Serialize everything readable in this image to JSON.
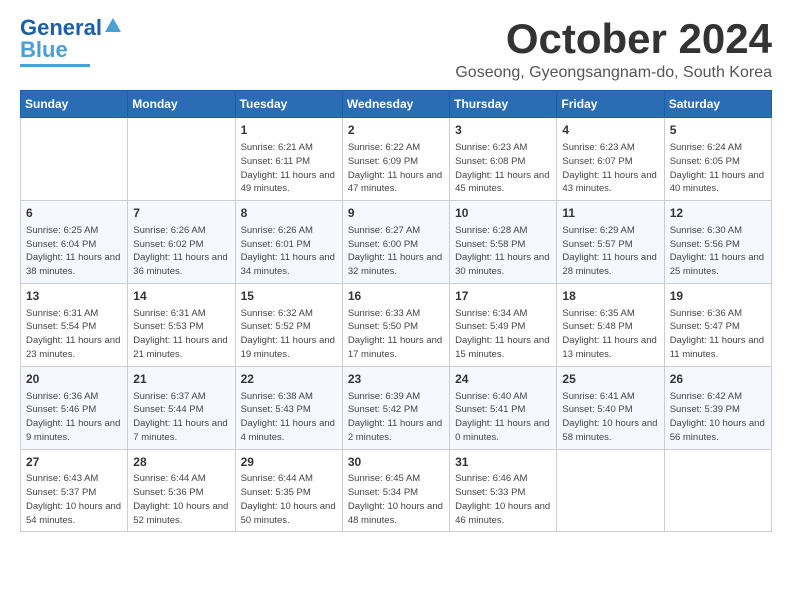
{
  "header": {
    "logo_line1": "General",
    "logo_line2": "Blue",
    "month_title": "October 2024",
    "subtitle": "Goseong, Gyeongsangnam-do, South Korea"
  },
  "days_of_week": [
    "Sunday",
    "Monday",
    "Tuesday",
    "Wednesday",
    "Thursday",
    "Friday",
    "Saturday"
  ],
  "weeks": [
    [
      {
        "day": "",
        "content": ""
      },
      {
        "day": "",
        "content": ""
      },
      {
        "day": "1",
        "content": "Sunrise: 6:21 AM\nSunset: 6:11 PM\nDaylight: 11 hours and 49 minutes."
      },
      {
        "day": "2",
        "content": "Sunrise: 6:22 AM\nSunset: 6:09 PM\nDaylight: 11 hours and 47 minutes."
      },
      {
        "day": "3",
        "content": "Sunrise: 6:23 AM\nSunset: 6:08 PM\nDaylight: 11 hours and 45 minutes."
      },
      {
        "day": "4",
        "content": "Sunrise: 6:23 AM\nSunset: 6:07 PM\nDaylight: 11 hours and 43 minutes."
      },
      {
        "day": "5",
        "content": "Sunrise: 6:24 AM\nSunset: 6:05 PM\nDaylight: 11 hours and 40 minutes."
      }
    ],
    [
      {
        "day": "6",
        "content": "Sunrise: 6:25 AM\nSunset: 6:04 PM\nDaylight: 11 hours and 38 minutes."
      },
      {
        "day": "7",
        "content": "Sunrise: 6:26 AM\nSunset: 6:02 PM\nDaylight: 11 hours and 36 minutes."
      },
      {
        "day": "8",
        "content": "Sunrise: 6:26 AM\nSunset: 6:01 PM\nDaylight: 11 hours and 34 minutes."
      },
      {
        "day": "9",
        "content": "Sunrise: 6:27 AM\nSunset: 6:00 PM\nDaylight: 11 hours and 32 minutes."
      },
      {
        "day": "10",
        "content": "Sunrise: 6:28 AM\nSunset: 5:58 PM\nDaylight: 11 hours and 30 minutes."
      },
      {
        "day": "11",
        "content": "Sunrise: 6:29 AM\nSunset: 5:57 PM\nDaylight: 11 hours and 28 minutes."
      },
      {
        "day": "12",
        "content": "Sunrise: 6:30 AM\nSunset: 5:56 PM\nDaylight: 11 hours and 25 minutes."
      }
    ],
    [
      {
        "day": "13",
        "content": "Sunrise: 6:31 AM\nSunset: 5:54 PM\nDaylight: 11 hours and 23 minutes."
      },
      {
        "day": "14",
        "content": "Sunrise: 6:31 AM\nSunset: 5:53 PM\nDaylight: 11 hours and 21 minutes."
      },
      {
        "day": "15",
        "content": "Sunrise: 6:32 AM\nSunset: 5:52 PM\nDaylight: 11 hours and 19 minutes."
      },
      {
        "day": "16",
        "content": "Sunrise: 6:33 AM\nSunset: 5:50 PM\nDaylight: 11 hours and 17 minutes."
      },
      {
        "day": "17",
        "content": "Sunrise: 6:34 AM\nSunset: 5:49 PM\nDaylight: 11 hours and 15 minutes."
      },
      {
        "day": "18",
        "content": "Sunrise: 6:35 AM\nSunset: 5:48 PM\nDaylight: 11 hours and 13 minutes."
      },
      {
        "day": "19",
        "content": "Sunrise: 6:36 AM\nSunset: 5:47 PM\nDaylight: 11 hours and 11 minutes."
      }
    ],
    [
      {
        "day": "20",
        "content": "Sunrise: 6:36 AM\nSunset: 5:46 PM\nDaylight: 11 hours and 9 minutes."
      },
      {
        "day": "21",
        "content": "Sunrise: 6:37 AM\nSunset: 5:44 PM\nDaylight: 11 hours and 7 minutes."
      },
      {
        "day": "22",
        "content": "Sunrise: 6:38 AM\nSunset: 5:43 PM\nDaylight: 11 hours and 4 minutes."
      },
      {
        "day": "23",
        "content": "Sunrise: 6:39 AM\nSunset: 5:42 PM\nDaylight: 11 hours and 2 minutes."
      },
      {
        "day": "24",
        "content": "Sunrise: 6:40 AM\nSunset: 5:41 PM\nDaylight: 11 hours and 0 minutes."
      },
      {
        "day": "25",
        "content": "Sunrise: 6:41 AM\nSunset: 5:40 PM\nDaylight: 10 hours and 58 minutes."
      },
      {
        "day": "26",
        "content": "Sunrise: 6:42 AM\nSunset: 5:39 PM\nDaylight: 10 hours and 56 minutes."
      }
    ],
    [
      {
        "day": "27",
        "content": "Sunrise: 6:43 AM\nSunset: 5:37 PM\nDaylight: 10 hours and 54 minutes."
      },
      {
        "day": "28",
        "content": "Sunrise: 6:44 AM\nSunset: 5:36 PM\nDaylight: 10 hours and 52 minutes."
      },
      {
        "day": "29",
        "content": "Sunrise: 6:44 AM\nSunset: 5:35 PM\nDaylight: 10 hours and 50 minutes."
      },
      {
        "day": "30",
        "content": "Sunrise: 6:45 AM\nSunset: 5:34 PM\nDaylight: 10 hours and 48 minutes."
      },
      {
        "day": "31",
        "content": "Sunrise: 6:46 AM\nSunset: 5:33 PM\nDaylight: 10 hours and 46 minutes."
      },
      {
        "day": "",
        "content": ""
      },
      {
        "day": "",
        "content": ""
      }
    ]
  ]
}
